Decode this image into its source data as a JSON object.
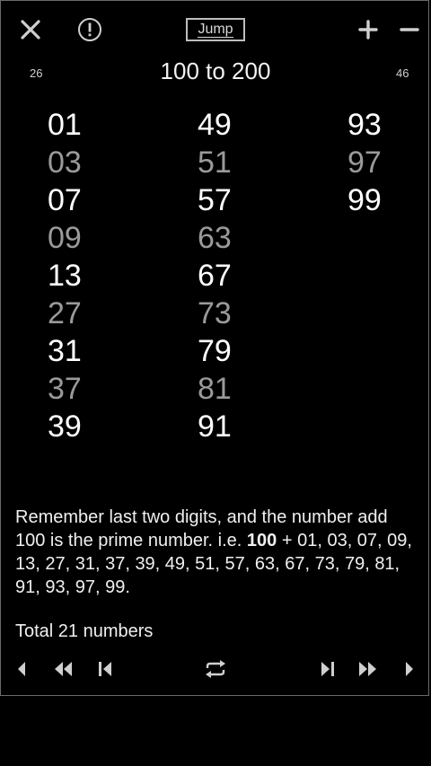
{
  "toolbar": {
    "jump_label": "Jump"
  },
  "range": {
    "left_count": "26",
    "title": "100 to 200",
    "right_count": "46"
  },
  "columns": [
    [
      "01",
      "03",
      "07",
      "09",
      "13",
      "27",
      "31",
      "37",
      "39"
    ],
    [
      "49",
      "51",
      "57",
      "63",
      "67",
      "73",
      "79",
      "81",
      "91"
    ],
    [
      "93",
      "97",
      "99"
    ]
  ],
  "description": {
    "text_before": "Remember last two digits, and the number add 100 is the prime number. i.e.  ",
    "bold": "100",
    "text_after": " + 01, 03, 07, 09, 13, 27, 31, 37, 39, 49, 51, 57, 63, 67, 73, 79, 81, 91, 93, 97, 99."
  },
  "total": "Total 21 numbers",
  "icons": {
    "close": "close-icon",
    "info": "info-icon",
    "plus": "plus-icon",
    "minus": "minus-icon",
    "prev": "prev-icon",
    "rewind": "rewind-icon",
    "skip_first": "skip-first-icon",
    "repeat": "repeat-icon",
    "skip_last": "skip-last-icon",
    "fast_forward": "fast-forward-icon",
    "next": "next-icon"
  },
  "colors": {
    "background": "#000000",
    "bright_text": "#ffffff",
    "dim_text": "#9a9a9a",
    "icon": "#cfcfcf"
  }
}
